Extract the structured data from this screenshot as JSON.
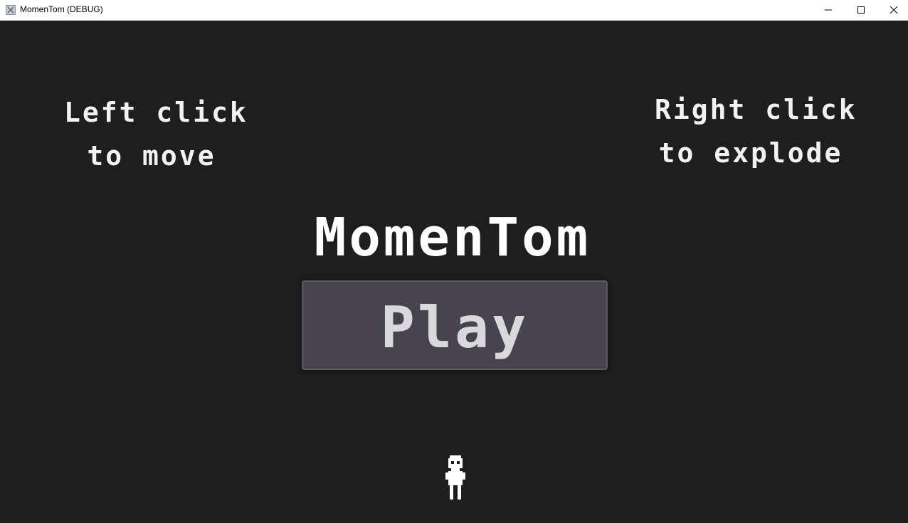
{
  "window": {
    "title": "MomenTom (DEBUG)",
    "controls": [
      "minimize",
      "maximize",
      "close"
    ]
  },
  "game": {
    "hint_left": {
      "line1": "Left click",
      "line2": "to move"
    },
    "hint_right": {
      "line1": "Right click",
      "line2": "to explode"
    },
    "title": "MomenTom",
    "play_button": "Play"
  },
  "colors": {
    "background": "#1f1e1f",
    "text": "#f2f2f2",
    "button_fill": "#47444f",
    "button_text": "#d9d9dc"
  }
}
